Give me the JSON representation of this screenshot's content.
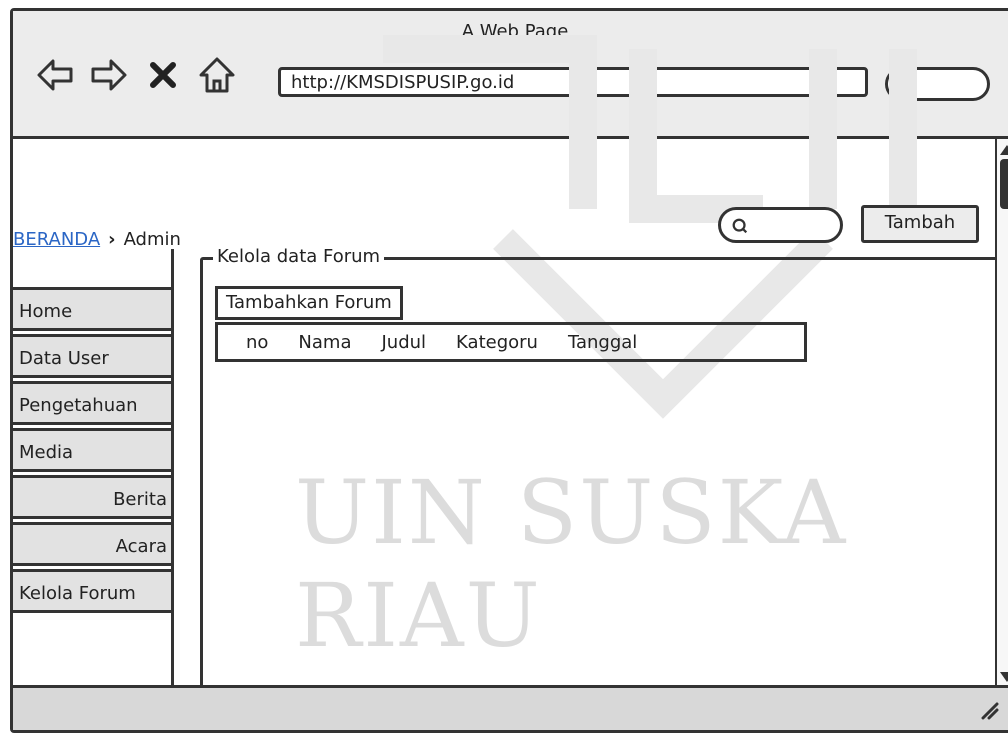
{
  "browser": {
    "title": "A Web Page",
    "url": "http://KMSDISPUSIP.go.id"
  },
  "breadcrumb": {
    "link": "BERANDA",
    "current": "Admin"
  },
  "toolbar": {
    "add_label": "Tambah"
  },
  "sidebar": {
    "items": [
      {
        "label": "Home"
      },
      {
        "label": "Data User"
      },
      {
        "label": "Pengetahuan"
      },
      {
        "label": "Media"
      },
      {
        "label": "Berita"
      },
      {
        "label": "Acara"
      },
      {
        "label": "Kelola Forum"
      }
    ]
  },
  "panel": {
    "legend": "Kelola data Forum",
    "add_button": "Tambahkan Forum",
    "columns": [
      "no",
      "Nama",
      "Judul",
      "Kategoru",
      "Tanggal"
    ]
  },
  "watermark": {
    "text": "UIN SUSKA RIAU"
  }
}
